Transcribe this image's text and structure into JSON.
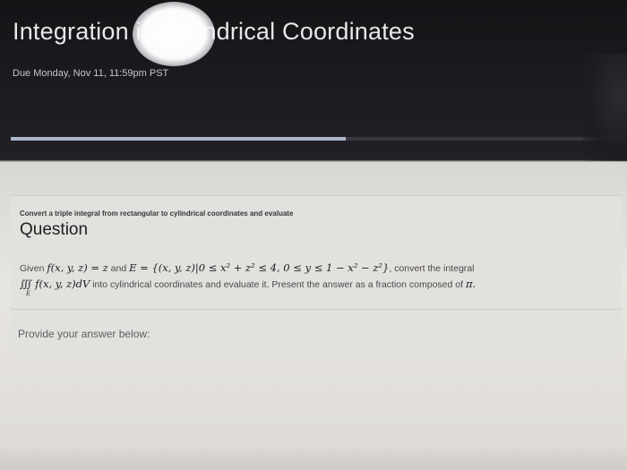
{
  "header": {
    "title": "Integration in Cylindrical Coordinates",
    "due": "Due Monday, Nov 11, 11:59pm PST",
    "progress": 0.55
  },
  "question": {
    "subtitle": "Convert a triple integral from rectangular to cylindrical coordinates and evaluate",
    "heading": "Question",
    "given_prefix": "Given",
    "f_expr": "f(x, y, z) = z",
    "and_word": "and",
    "e_expr": "E = {(x, y, z)|0 ≤ x² + z² ≤ 4, 0 ≤ y ≤ 1 − x² − z²}",
    "convert_text": ", convert the integral",
    "integral_expr": "∭ f(x, y, z)dV",
    "integral_sub": "E",
    "line2_text": " into cylindrical coordinates and evaluate it. Present the answer as a fraction composed of",
    "pi": "π."
  },
  "answer": {
    "prompt": "Provide your answer below:"
  }
}
